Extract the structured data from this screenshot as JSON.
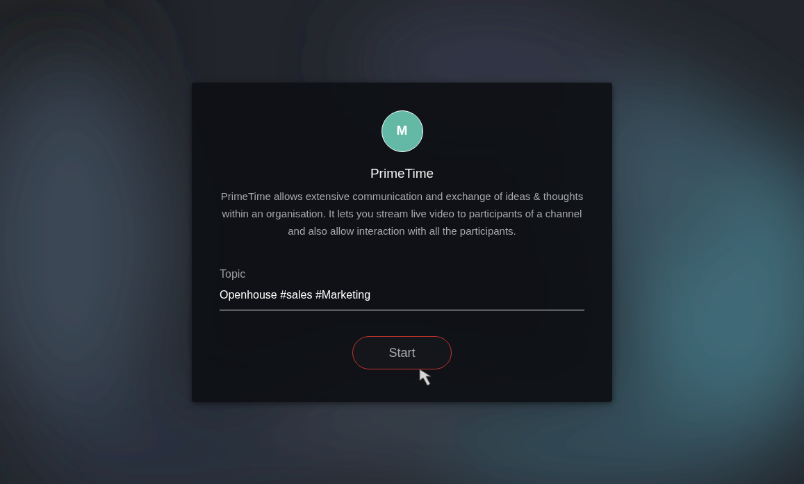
{
  "app": {
    "avatar_letter": "M",
    "title": "PrimeTime",
    "description": "PrimeTime allows extensive communication and exchange of ideas & thoughts within an organisation. It lets you stream live video to participants of a channel and also allow interaction with all the participants."
  },
  "topic_field": {
    "label": "Topic",
    "value": "Openhouse #sales #Marketing"
  },
  "start_button": {
    "label": "Start",
    "hovered": true
  }
}
